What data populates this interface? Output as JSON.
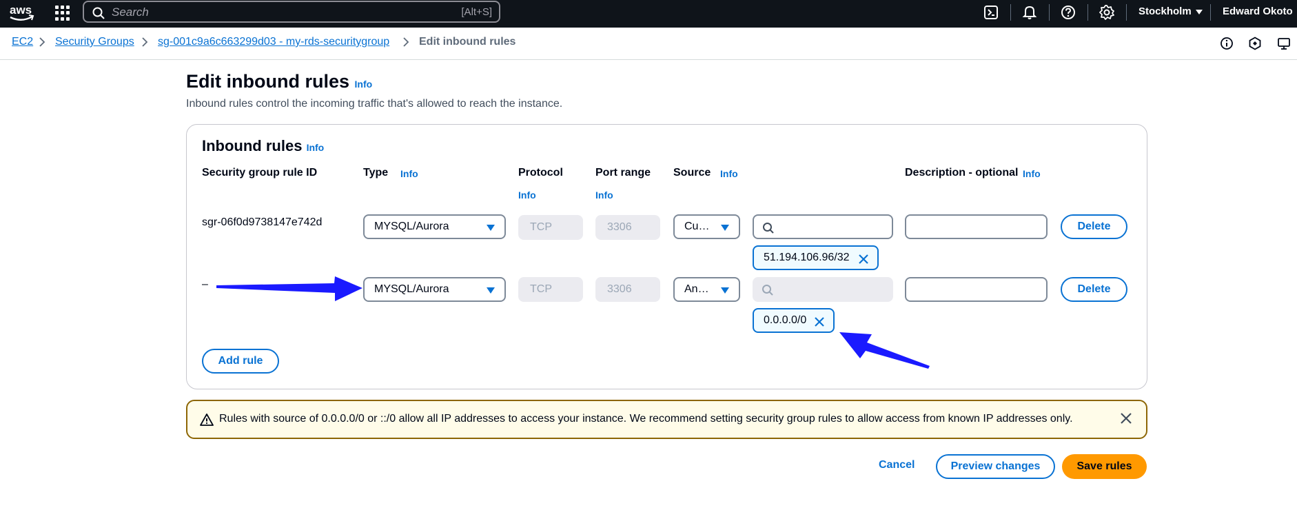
{
  "topnav": {
    "logo": "aws",
    "search_placeholder": "Search",
    "search_shortcut": "[Alt+S]",
    "region": "Stockholm",
    "user": "Edward Okoto",
    "icons": [
      "apps-grid-icon",
      "search-icon",
      "cloudshell-icon",
      "bell-icon",
      "help-icon",
      "gear-icon"
    ]
  },
  "breadcrumb": {
    "items": [
      "EC2",
      "Security Groups",
      "sg-001c9a6c663299d03 - my-rds-securitygroup"
    ],
    "current": "Edit inbound rules"
  },
  "page": {
    "title": "Edit inbound rules",
    "title_info": "Info",
    "subtitle": "Inbound rules control the incoming traffic that's allowed to reach the instance."
  },
  "panel": {
    "title": "Inbound rules",
    "title_info": "Info",
    "columns": {
      "rule_id": "Security group rule ID",
      "type": "Type",
      "protocol": "Protocol",
      "port_range": "Port range",
      "source": "Source",
      "description": "Description - optional",
      "info": "Info"
    },
    "rows": [
      {
        "rule_id": "sgr-06f0d9738147e742d",
        "type": "MYSQL/Aurora",
        "protocol": "TCP",
        "port_range": "3306",
        "source": "Cu…",
        "token": "51.194.106.96/32",
        "delete": "Delete"
      },
      {
        "rule_id": "–",
        "type": "MYSQL/Aurora",
        "protocol": "TCP",
        "port_range": "3306",
        "source": "An…",
        "token": "0.0.0.0/0",
        "delete": "Delete"
      }
    ],
    "add_rule": "Add rule"
  },
  "alert": {
    "message": "Rules with source of 0.0.0.0/0 or ::/0 allow all IP addresses to access your instance. We recommend setting security group rules to allow access from known IP addresses only."
  },
  "footer": {
    "cancel": "Cancel",
    "preview": "Preview changes",
    "save": "Save rules"
  },
  "colors": {
    "accent": "#0972d3",
    "primary": "#ff9900",
    "annotation": "#1a1aff"
  }
}
